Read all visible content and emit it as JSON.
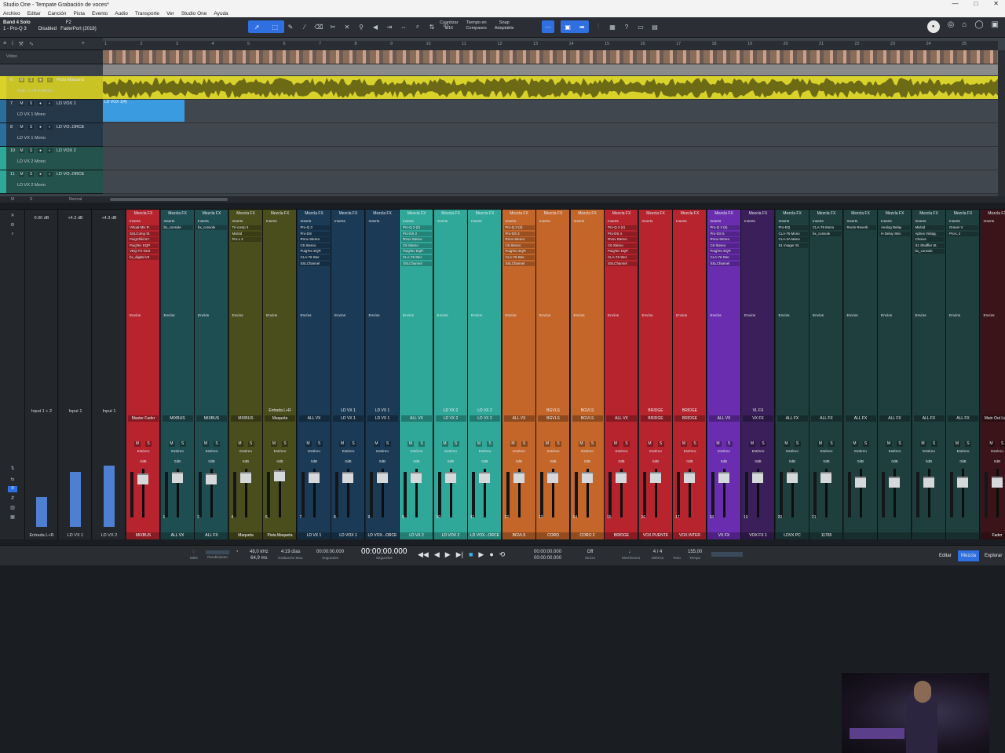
{
  "window": {
    "title": "Studio One - Tempate Grabación de voces*",
    "controls": [
      "—",
      "□",
      "✕"
    ]
  },
  "menu": [
    "Archivo",
    "Editar",
    "Canción",
    "Pista",
    "Evento",
    "Audio",
    "Transporte",
    "Ver",
    "Studio One",
    "Ayuda"
  ],
  "toolbar": {
    "song_name": "Band 4 Solo",
    "preset": "1 - Pro-Q 3",
    "key": "F2",
    "disabled": "Disabled",
    "device": "FaderPort (2018)",
    "quantize_label": "Cuantizar",
    "quantize_value": "1/16",
    "timebase_label": "Tiempo en",
    "timebase_value": "Compases",
    "snap_label": "Snap",
    "snap_value": "Adaptable",
    "iq": "IQ"
  },
  "arrange": {
    "video_label": "Video",
    "ruler": [
      "1",
      "2",
      "3",
      "4",
      "5",
      "6",
      "7",
      "8",
      "9",
      "10",
      "11",
      "12",
      "13",
      "14",
      "15",
      "16",
      "17",
      "18",
      "19",
      "20",
      "21",
      "22",
      "23",
      "24",
      "25"
    ],
    "tracks": [
      {
        "num": "6",
        "name": "Pista Maqueta",
        "sub": "Entr.: L+R Estéreo",
        "color": "#d8d22a"
      },
      {
        "num": "7",
        "name": "LD VOX 1",
        "sub": "LD VX 1   Mono",
        "color": "#2b6e9c"
      },
      {
        "num": "8",
        "name": "LD VO..ORCE",
        "sub": "LD VX 1   Mono",
        "color": "#2b6e9c"
      },
      {
        "num": "10",
        "name": "LD VOX 2",
        "sub": "LD VX 2   Mono",
        "color": "#2fa89a"
      },
      {
        "num": "11",
        "name": "LD VO..ORCE",
        "sub": "LD VX 2   Mono",
        "color": "#2fa89a"
      }
    ],
    "clip_label": "LD VOX 1(4)",
    "bottom_mode": "Normal"
  },
  "mixer": {
    "inputs": [
      {
        "name": "Input 1 + 2",
        "foot": "Entrada L+R"
      },
      {
        "name": "Input 1",
        "foot": "LD VX 1"
      },
      {
        "name": "Input 1",
        "foot": "LD VX 2"
      }
    ],
    "input_db": [
      "0.00 dB",
      "+4.3 dB",
      "+4.3 dB"
    ],
    "channels": [
      {
        "color": "#b7242e",
        "hd": "Mezcla FX",
        "ins": [
          "Virtual Mix R.",
          "SSLComp St.",
          "PuigChild 67.",
          "PuigTec EQP.",
          "VEQ FX-Gret",
          "bx_digital V3"
        ],
        "io1": "",
        "io2": "Master Fader",
        "num": "",
        "foot": "MIXBUS"
      },
      {
        "color": "#1f4e52",
        "hd": "Mezcla FX",
        "ins": [
          "bx_console"
        ],
        "io1": "",
        "io2": "MIXBUS",
        "num": "1",
        "foot": "ALL VX"
      },
      {
        "color": "#1f4e52",
        "hd": "Mezcla FX",
        "ins": [
          "bx_console"
        ],
        "io1": "",
        "io2": "MIXBUS",
        "num": "3",
        "foot": "ALL FX"
      },
      {
        "color": "#4a4d1c",
        "hd": "Mezcla FX",
        "ins": [
          "Tri-comp 3",
          "Mixbid",
          "Pro-L 2"
        ],
        "io1": "",
        "io2": "MIXBUS",
        "num": "4",
        "foot": "Maqueta"
      },
      {
        "color": "#4a4d1c",
        "hd": "Mezcla FX",
        "ins": [],
        "io1": "Entrada L+R",
        "io2": "Maqueta",
        "num": "6",
        "foot": "Pista Maqueta"
      },
      {
        "color": "#1b3a55",
        "hd": "Mezcla FX",
        "ins": [
          "Pro-Q 3",
          "Pro-DS",
          "RVox Stereo",
          "C6 Stereo",
          "PuigTec EQP.",
          "CLA-76 Ster.",
          "SSLChannel"
        ],
        "io1": "",
        "io2": "ALL VX",
        "num": "7",
        "foot": "LD VX 1"
      },
      {
        "color": "#1b3a55",
        "hd": "Mezcla FX",
        "ins": [],
        "io1": "LD VX 1",
        "io2": "LD VX 1",
        "num": "8",
        "foot": "LD VOX 1"
      },
      {
        "color": "#1b3a55",
        "hd": "Mezcla FX",
        "ins": [],
        "io1": "LD VX 1",
        "io2": "LD VX 1",
        "num": "9",
        "foot": "LD VOX...ORCE"
      },
      {
        "color": "#2fa89a",
        "hd": "Mezcla FX",
        "ins": [
          "Pro-Q 3 (2)",
          "Pro-DS 2",
          "RVox Stereo",
          "C6 Stereo",
          "PuigTec EQP.",
          "CLA-76 Ster.",
          "SSLChannel"
        ],
        "io1": "",
        "io2": "ALL VX",
        "num": "9",
        "foot": "LD VX 2"
      },
      {
        "color": "#2fa89a",
        "hd": "Mezcla FX",
        "ins": [],
        "io1": "LD VX 2",
        "io2": "LD VX 2",
        "num": "10",
        "foot": "LD VOX 2"
      },
      {
        "color": "#2fa89a",
        "hd": "Mezcla FX",
        "ins": [],
        "io1": "LD VX 2",
        "io2": "LD VX 2",
        "num": "11",
        "foot": "LD VOX...ORCE"
      },
      {
        "color": "#c4662a",
        "hd": "Mezcla FX",
        "ins": [
          "Pro-Q 3 (3)",
          "Pro-DS 3",
          "RVox Stereo",
          "C6 Stereo",
          "PuigTec EQP.",
          "CLA-76 Ster.",
          "SSLChannel"
        ],
        "io1": "",
        "io2": "ALL VX",
        "num": "12",
        "foot": "BGVLS"
      },
      {
        "color": "#c4662a",
        "hd": "Mezcla FX",
        "ins": [],
        "io1": "BGVLS",
        "io2": "BGVLS",
        "num": "13",
        "foot": "CORO"
      },
      {
        "color": "#c4662a",
        "hd": "Mezcla FX",
        "ins": [],
        "io1": "BGVLS",
        "io2": "BGVLS",
        "num": "14",
        "foot": "CORO 2"
      },
      {
        "color": "#b7242e",
        "hd": "Mezcla FX",
        "ins": [
          "Pro-Q 3 (4)",
          "Pro-DS 4",
          "RVox Stereo",
          "C6 Stereo",
          "PuigTec EQP.",
          "CLA-76 Ster.",
          "SSLChannel"
        ],
        "io1": "",
        "io2": "ALL VX",
        "num": "15",
        "foot": "BRIDGE"
      },
      {
        "color": "#b7242e",
        "hd": "Mezcla FX",
        "ins": [],
        "io1": "BRIDGE",
        "io2": "BRIDGE",
        "num": "16",
        "foot": "VOX PUENTE"
      },
      {
        "color": "#b7242e",
        "hd": "Mezcla FX",
        "ins": [],
        "io1": "BRIDGE",
        "io2": "BRIDGE",
        "num": "17",
        "foot": "VOX INTER"
      },
      {
        "color": "#6a2db0",
        "hd": "Mezcla FX",
        "ins": [
          "Pro-Q 3 (5)",
          "Pro-DS 5",
          "RVox Stereo",
          "C6 Stereo",
          "PuigTec EQP.",
          "CLA-76 Ster.",
          "SSLChannel"
        ],
        "io1": "",
        "io2": "ALL VX",
        "num": "18",
        "foot": "VX FX"
      },
      {
        "color": "#3a1f5a",
        "hd": "Mezcla FX",
        "ins": [],
        "io1": "VL FX",
        "io2": "VX FX",
        "num": "19",
        "foot": "VOX FX 1"
      },
      {
        "color": "#1f3e3e",
        "hd": "Mezcla FX",
        "ins": [
          "Pro-EQ",
          "CLA-76 Mono",
          "CLA-2A Mono",
          "S1 Imager St."
        ],
        "io1": "",
        "io2": "ALL FX",
        "num": "20",
        "foot": "LDVX PC"
      },
      {
        "color": "#1f3e3e",
        "hd": "Mezcla FX",
        "ins": [
          "CLA-76 Mono",
          "bx_console"
        ],
        "io1": "",
        "io2": "ALL FX",
        "num": "21",
        "foot": "11765"
      },
      {
        "color": "#1f3e3e",
        "hd": "Mezcla FX",
        "ins": [
          "Room Reverb"
        ],
        "io1": "",
        "io2": "ALL FX",
        "num": "",
        "foot": ""
      },
      {
        "color": "#1f3e3e",
        "hd": "Mezcla FX",
        "ins": [
          "Analog Delay",
          "H-Delay Ster."
        ],
        "io1": "",
        "io2": "ALL FX",
        "num": "",
        "foot": ""
      },
      {
        "color": "#1f3e3e",
        "hd": "Mezcla FX",
        "ins": [
          "Mixbid",
          "Aphex Vintag.",
          "Chorus",
          "S1 Shuffler St.",
          "bx_console"
        ],
        "io1": "",
        "io2": "ALL FX",
        "num": "",
        "foot": ""
      },
      {
        "color": "#1f3e3e",
        "hd": "Mezcla FX",
        "ins": [
          "Graver V",
          "Pro-L 2"
        ],
        "io1": "",
        "io2": "ALL FX",
        "num": "",
        "foot": ""
      },
      {
        "color": "#3a1418",
        "hd": "Mezcla FX",
        "ins": [],
        "io1": "",
        "io2": "Main Out Light",
        "num": "",
        "foot": "Fader"
      }
    ],
    "labels": {
      "inserts": "Inserts",
      "sends": "Envíos",
      "stereo": "Estéreo",
      "db": "0dB",
      "auto": "Auto: de",
      "post": "Post"
    }
  },
  "transport": {
    "midi": "MIDI",
    "performance": "Rendimiento",
    "sample_rate": "48,0 kHz",
    "record_time": "4:19 días",
    "buffer": "64,9 ms",
    "record_max": "Grabación Max.",
    "sec_top": "00:00:00.000",
    "sec_label": "Segundos",
    "main_time": "00:00:00.000",
    "main_label": "Segundos",
    "loop_top": "00:00:00.000",
    "loop_bottom": "00:00:00.000",
    "sync": "Off",
    "sync_label": "Sincro",
    "metronome": "Metrónomo",
    "signature": "4 / 4",
    "signature_label": "Métrica",
    "key_label": "Tono",
    "tempo": "155,00",
    "tempo_label": "Tempo",
    "btn_edit": "Editar",
    "btn_mix": "Mezcla",
    "btn_browse": "Explorar"
  }
}
